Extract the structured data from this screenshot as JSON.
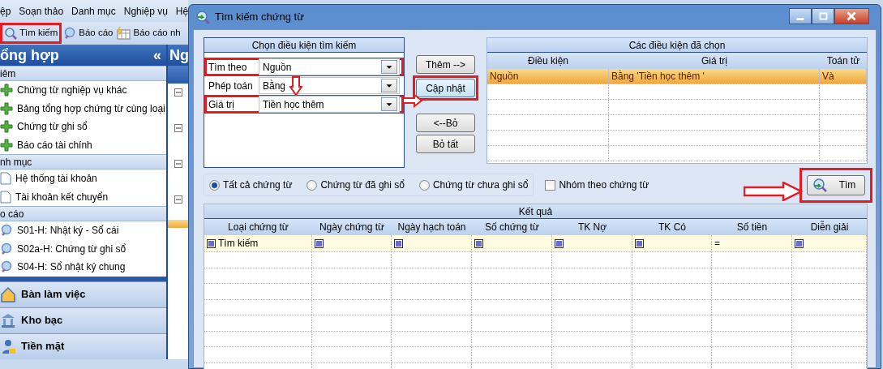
{
  "app": {
    "menu": [
      "ệp",
      "Soạn thảo",
      "Danh mục",
      "Nghiệp vụ",
      "Hệ"
    ],
    "toolbar": [
      {
        "label": "Tìm kiếm",
        "kind": "search",
        "highlighted": true
      },
      {
        "label": "Báo cáo",
        "kind": "report",
        "highlighted": false
      },
      {
        "label": "Báo cáo nh",
        "kind": "calendar",
        "highlighted": false
      }
    ],
    "sidebar": {
      "title": "ổng hợp",
      "collapse": "«",
      "sections": [
        {
          "title": "iêm",
          "kind": "add",
          "items": [
            "Chứng từ nghiệp vụ khác",
            "Bảng tổng hợp chứng từ cùng loại",
            "Chứng từ ghi sổ",
            "Báo cáo tài chính"
          ]
        },
        {
          "title": "nh mục",
          "kind": "document",
          "items": [
            "Hệ thống tài khoản",
            "Tài khoản kết chuyển"
          ]
        },
        {
          "title": "o cáo",
          "kind": "report",
          "items": [
            "S01-H: Nhật ký - Sổ cái",
            "S02a-H: Chứng từ ghi sổ",
            "S04-H: Sổ nhật ký chung"
          ]
        }
      ]
    },
    "nav_buttons": [
      {
        "label": "Bàn làm việc",
        "kind": "home"
      },
      {
        "label": "Kho bạc",
        "kind": "bank"
      },
      {
        "label": "Tiền mặt",
        "kind": "cash"
      }
    ],
    "side_panel": {
      "title": "Ng"
    }
  },
  "dialog": {
    "title": "Tìm kiếm chứng từ",
    "criteria": {
      "title": "Chọn điều kiện tìm kiếm",
      "fields": [
        {
          "label": "Tìm theo",
          "value": "Nguồn",
          "highlighted": true
        },
        {
          "label": "Phép toán",
          "value": "Bằng",
          "highlighted": false
        },
        {
          "label": "Giá trị",
          "value": "Tiền học thêm",
          "highlighted": true
        }
      ]
    },
    "actions": [
      {
        "label": "Thêm -->",
        "focused": false,
        "highlighted": false
      },
      {
        "label": "Cập nhật",
        "focused": true,
        "highlighted": true
      },
      {
        "label": "<--Bỏ",
        "focused": false,
        "highlighted": false
      },
      {
        "label": "Bỏ tất",
        "focused": false,
        "highlighted": false
      }
    ],
    "chosen": {
      "title": "Các điều kiện đã chọn",
      "columns": [
        "Điều kiện",
        "Giá trị",
        "Toán tử"
      ],
      "rows": [
        {
          "cells": [
            "Nguồn",
            "Bằng 'Tiền học thêm '",
            "Và"
          ],
          "selected": true
        }
      ]
    },
    "filters": [
      {
        "kind": "radio",
        "label": "Tất cả chứng từ",
        "selected": true
      },
      {
        "kind": "radio",
        "label": "Chứng từ đã ghi sổ",
        "selected": false
      },
      {
        "kind": "radio",
        "label": "Chứng từ chưa ghi sổ",
        "selected": false
      },
      {
        "kind": "checkbox",
        "label": "Nhóm theo chứng từ",
        "checked": false
      }
    ],
    "search_button": {
      "label": "Tìm",
      "highlighted": true
    },
    "results": {
      "title": "Kết quả",
      "columns": [
        "Loại chứng từ",
        "Ngày chứng từ",
        "Ngày hạch toán",
        "Số chứng từ",
        "TK Nợ",
        "TK Có",
        "Số tiền",
        "Diễn giải"
      ],
      "filter_row": [
        {
          "kind": "icon",
          "text": "Tìm kiếm"
        },
        {
          "kind": "icon"
        },
        {
          "kind": "icon"
        },
        {
          "kind": "icon"
        },
        {
          "kind": "icon"
        },
        {
          "kind": "icon"
        },
        {
          "kind": "operator",
          "text": "="
        },
        {
          "kind": "icon"
        }
      ]
    }
  }
}
